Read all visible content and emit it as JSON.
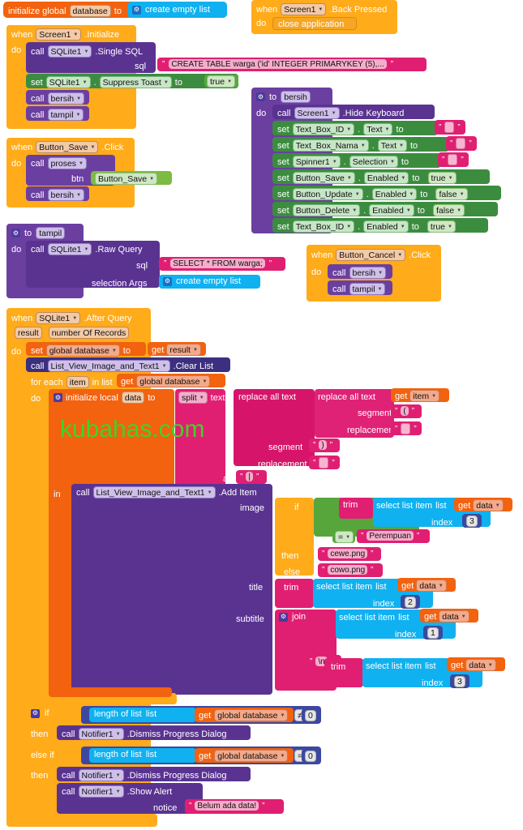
{
  "meta": {
    "app": "MIT App Inventor Blocks Editor",
    "watermark": "kubahas.com"
  },
  "words": {
    "when": "when",
    "do": "do",
    "to": "to",
    "call": "call",
    "set": "set",
    "get": "get",
    "if": "if",
    "then": "then",
    "else": "else",
    "else_if": "else if",
    "in": "in",
    "at": "at",
    "result": "result",
    "number_of_records": "number Of Records",
    "for_each": "for each",
    "in_list": "in list",
    "initialize_local": "initialize local",
    "initialize_global": "initialize global",
    "list": "list",
    "index": "index",
    "text": "text",
    "segment": "segment",
    "replacement": "replacement",
    "image": "image",
    "title": "title",
    "subtitle": "subtitle",
    "notice": "notice",
    "sql": "sql",
    "selection_args": "selection Args",
    "btn": "btn",
    "quote": "”"
  },
  "blocks": {
    "init_global_database": {
      "label": "initialize global",
      "name": "database",
      "to": "to",
      "value": "create empty list"
    },
    "screen1_backpressed": {
      "when": "when",
      "component": "Screen1",
      "event": ".Back Pressed",
      "do": "do",
      "body": "close application"
    },
    "screen1_initialize": {
      "when": "when",
      "component": "Screen1",
      "event": ".Initialize",
      "do": "do",
      "rows": [
        {
          "call": "call",
          "target": "SQLite1",
          "method": ".Single SQL"
        },
        {
          "arg": "sql",
          "value": "CREATE TABLE warga ('id' INTEGER PRIMARYKEY (5),..."
        },
        {
          "set": "set",
          "target": "SQLite1",
          "prop": "Suppress Toast",
          "to": "to",
          "value": "true"
        },
        {
          "call": "call",
          "target": "bersih"
        },
        {
          "call": "call",
          "target": "tampil"
        }
      ]
    },
    "proc_bersih": {
      "to": "to",
      "name": "bersih",
      "do": "do",
      "call_row": {
        "call": "call",
        "target": "Screen1",
        "method": ".Hide Keyboard"
      },
      "sets": [
        {
          "set": "set",
          "component": "Text_Box_ID",
          "prop": "Text",
          "to": "to",
          "value": "",
          "kind": "empty-string"
        },
        {
          "set": "set",
          "component": "Text_Box_Nama",
          "prop": "Text",
          "to": "to",
          "value": "",
          "kind": "empty-string"
        },
        {
          "set": "set",
          "component": "Spinner1",
          "prop": "Selection",
          "to": "to",
          "value": "",
          "kind": "empty-string"
        },
        {
          "set": "set",
          "component": "Button_Save",
          "prop": "Enabled",
          "to": "to",
          "value": "true",
          "kind": "logic"
        },
        {
          "set": "set",
          "component": "Button_Update",
          "prop": "Enabled",
          "to": "to",
          "value": "false",
          "kind": "logic"
        },
        {
          "set": "set",
          "component": "Button_Delete",
          "prop": "Enabled",
          "to": "to",
          "value": "false",
          "kind": "logic"
        },
        {
          "set": "set",
          "component": "Text_Box_ID",
          "prop": "Enabled",
          "to": "to",
          "value": "true",
          "kind": "logic"
        }
      ]
    },
    "button_save_click": {
      "when": "when",
      "component": "Button_Save",
      "event": ".Click",
      "do": "do",
      "call_proses": {
        "call": "call",
        "target": "proses"
      },
      "arg_label": "btn",
      "arg_value": "Button_Save",
      "call_bersih": {
        "call": "call",
        "target": "bersih"
      }
    },
    "proc_tampil": {
      "to": "to",
      "name": "tampil",
      "do": "do",
      "call": "call",
      "target": "SQLite1",
      "method": ".Raw Query",
      "sql_label": "sql",
      "sql_value": "SELECT * FROM warga;",
      "args_label": "selection Args",
      "args_value": "create empty list"
    },
    "button_cancel_click": {
      "when": "when",
      "component": "Button_Cancel",
      "event": ".Click",
      "do": "do",
      "calls": [
        {
          "call": "call",
          "target": "bersih"
        },
        {
          "call": "call",
          "target": "tampil"
        }
      ]
    },
    "sqlite_after_query": {
      "when": "when",
      "component": "SQLite1",
      "event": ".After Query",
      "params": [
        "result",
        "number Of Records"
      ],
      "do": "do",
      "set_global": {
        "set": "set",
        "var": "global database",
        "to": "to",
        "get": "get",
        "value": "result"
      },
      "clear_list": {
        "call": "call",
        "target": "List_View_Image_and_Text1",
        "method": ".Clear List"
      },
      "for_each": {
        "label": "for each",
        "item": "item",
        "in_list": "in list",
        "get": "get",
        "value": "global database"
      },
      "local": {
        "do": "do",
        "label": "initialize local",
        "name": "data",
        "to": "to",
        "split": "split",
        "text_label": "text",
        "replace_outer": "replace all text",
        "replace_inner": "replace all text",
        "get": "get",
        "get_value": "item",
        "inner_segment_label": "segment",
        "inner_segment_value": "(",
        "inner_replacement_label": "replacement",
        "inner_replacement_value": "",
        "outer_segment_label": "segment",
        "outer_segment_value": ")",
        "outer_replacement_label": "replacement",
        "outer_replacement_value": "",
        "at_label": "at",
        "at_value": "|"
      },
      "add_item": {
        "in": "in",
        "call": "call",
        "target": "List_View_Image_and_Text1",
        "method": ".Add Item",
        "image_label": "image",
        "if_label": "if",
        "then_label": "then",
        "else_label": "else",
        "trim": "trim",
        "select_list_item": "select list item",
        "list_label": "list",
        "get": "get",
        "get_value": "data",
        "index_label": "index",
        "index_value": "3",
        "compare_op": "=",
        "compare_value": "Perempuan",
        "then_value": "cewe.png",
        "else_value": "cowo.png",
        "title_label": "title",
        "title_index": "2",
        "subtitle_label": "subtitle",
        "join": "join",
        "subtitle_index_1": "1",
        "newline_value": "\\n",
        "subtitle_index_2": "3"
      },
      "tail_if": {
        "if": "if",
        "then": "then",
        "else_if": "else if",
        "branches": [
          {
            "length_of_list": "length of list",
            "list_label": "list",
            "get": "get",
            "var": "global database",
            "op": "≠",
            "number": "0",
            "then_call": {
              "call": "call",
              "target": "Notifier1",
              "method": ".Dismiss Progress Dialog"
            }
          },
          {
            "length_of_list": "length of list",
            "list_label": "list",
            "get": "get",
            "var": "global database",
            "op": "=",
            "number": "0",
            "then_call": {
              "call": "call",
              "target": "Notifier1",
              "method": ".Dismiss Progress Dialog"
            },
            "alert_call": {
              "call": "call",
              "target": "Notifier1",
              "method": ".Show Alert"
            },
            "notice_label": "notice",
            "notice_value": "Belum ada data!"
          }
        ]
      }
    }
  },
  "colors": {
    "event": "#ffab1a",
    "procedure": "#6b3fa0",
    "variable": "#f2620f",
    "text": "#e01f72",
    "list": "#10b1f0",
    "math": "#3c48a0",
    "logic": "#56a83b",
    "control": "#ffab1a",
    "component_set": "#3c8c40",
    "component_call": "#5a3391",
    "watermark": "#3fd327"
  }
}
